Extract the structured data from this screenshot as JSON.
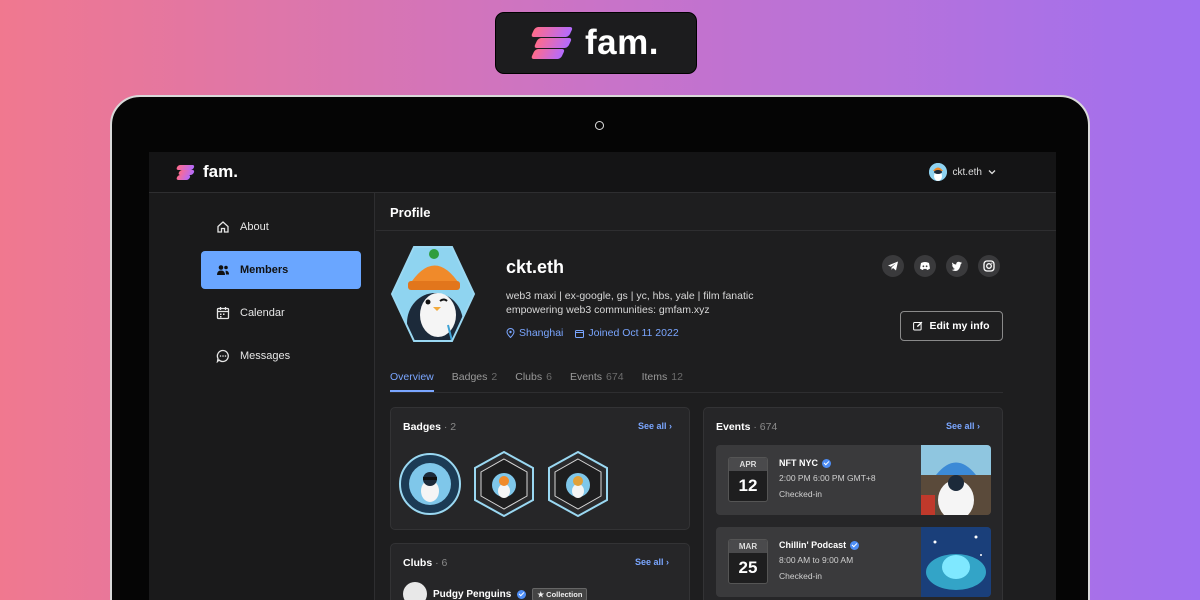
{
  "brand": {
    "name": "fam."
  },
  "app": {
    "logo_text": "fam."
  },
  "user_menu": {
    "username": "ckt.eth"
  },
  "sidebar": {
    "items": [
      {
        "label": "About",
        "icon": "home-icon"
      },
      {
        "label": "Members",
        "icon": "users-icon",
        "active": true
      },
      {
        "label": "Calendar",
        "icon": "calendar-icon"
      },
      {
        "label": "Messages",
        "icon": "chat-icon"
      }
    ]
  },
  "page": {
    "title": "Profile"
  },
  "profile": {
    "name": "ckt.eth",
    "bio_line1": "web3 maxi | ex-google, gs | yc, hbs, yale | film fanatic",
    "bio_line2": "empowering web3 communities: gmfam.xyz",
    "location": "Shanghai",
    "joined": "Joined Oct 11 2022",
    "edit_label": "Edit my info",
    "socials": [
      "telegram-icon",
      "discord-icon",
      "twitter-icon",
      "instagram-icon"
    ]
  },
  "tabs": [
    {
      "label": "Overview",
      "count": ""
    },
    {
      "label": "Badges",
      "count": "2"
    },
    {
      "label": "Clubs",
      "count": "6"
    },
    {
      "label": "Events",
      "count": "674"
    },
    {
      "label": "Items",
      "count": "12"
    }
  ],
  "badges_card": {
    "title": "Badges",
    "count": "· 2",
    "see_all": "See all"
  },
  "events_card": {
    "title": "Events",
    "count": "· 674",
    "see_all": "See all",
    "events": [
      {
        "month": "APR",
        "day": "12",
        "name": "NFT NYC",
        "time": "2:00 PM  6:00 PM GMT+8",
        "status": "Checked-in"
      },
      {
        "month": "MAR",
        "day": "25",
        "name": "Chillin' Podcast",
        "time": "8:00 AM to 9:00 AM",
        "status": "Checked-in"
      }
    ]
  },
  "clubs_card": {
    "title": "Clubs",
    "count": "· 6",
    "see_all": "See all",
    "club_name": "Pudgy Penguins",
    "tag": "Collection"
  },
  "colors": {
    "accent": "#7aa6ff",
    "active_nav": "#6aa6ff",
    "background_from": "#f0788f",
    "background_to": "#a070f0"
  }
}
